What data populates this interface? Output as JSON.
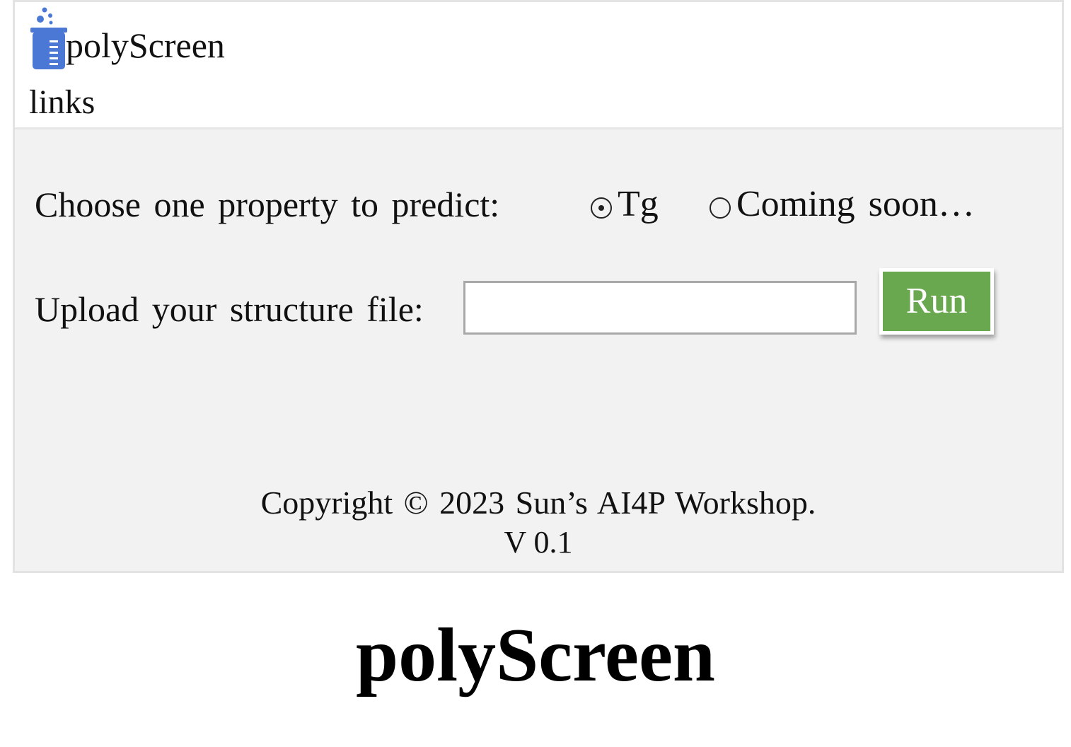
{
  "header": {
    "app_name": "polyScreen",
    "logo_icon": "beaker-icon",
    "nav_links_label": "links"
  },
  "form": {
    "property_label": "Choose one property to predict:",
    "options": [
      {
        "label": "Tg",
        "selected": true
      },
      {
        "label": "Coming soon…",
        "selected": false
      }
    ],
    "upload_label": "Upload your structure file:",
    "file_value": "",
    "run_label": "Run"
  },
  "footer": {
    "copyright": "Copyright © 2023 Sun’s AI4P Workshop.",
    "version": "V 0.1"
  },
  "caption": "polyScreen",
  "colors": {
    "run_button": "#6aa84f",
    "logo_blue": "#4a78d4",
    "content_background": "#f2f2f2"
  }
}
